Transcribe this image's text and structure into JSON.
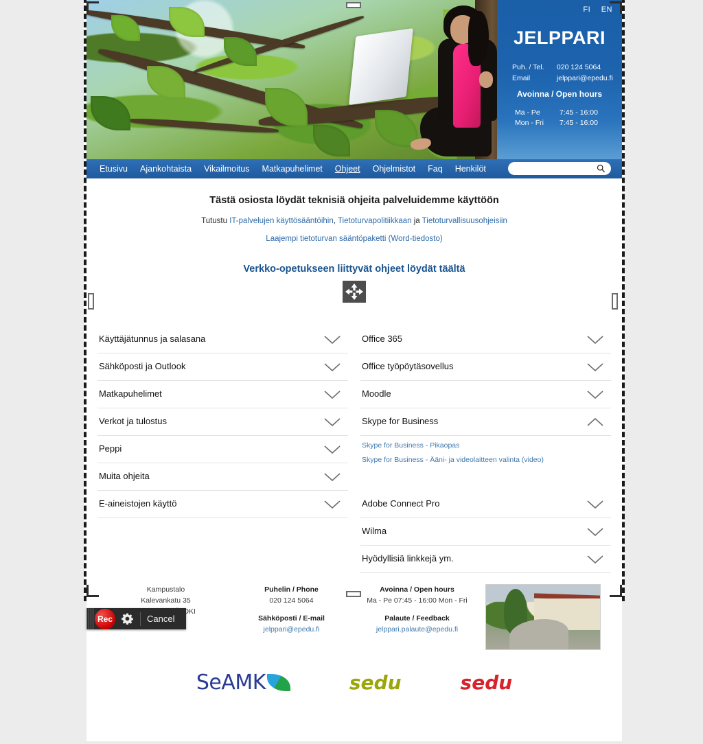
{
  "recorder": {
    "rec_label": "Rec",
    "cancel_label": "Cancel",
    "gear_icon": "gear-icon",
    "grip_icon": "drag-grip-icon"
  },
  "hero": {
    "lang": {
      "fi": "FI",
      "en": "EN"
    },
    "brand": "JELPPARI",
    "phone_label": "Puh. / Tel.",
    "phone_value": "020 124 5064",
    "email_label": "Email",
    "email_value": "jelppari@epedu.fi",
    "open_hours_title": "Avoinna / Open hours",
    "hours": [
      {
        "days": "Ma - Pe",
        "time": "7:45 - 16:00"
      },
      {
        "days": "Mon - Fri",
        "time": "7:45 - 16:00"
      }
    ]
  },
  "nav": {
    "items": [
      {
        "label": "Etusivu",
        "active": false
      },
      {
        "label": "Ajankohtaista",
        "active": false
      },
      {
        "label": "Vikailmoitus",
        "active": false
      },
      {
        "label": "Matkapuhelimet",
        "active": false
      },
      {
        "label": "Ohjeet",
        "active": true
      },
      {
        "label": "Ohjelmistot",
        "active": false
      },
      {
        "label": "Faq",
        "active": false
      },
      {
        "label": "Henkilöt",
        "active": false
      }
    ],
    "search_value": "",
    "search_placeholder": "",
    "search_icon": "search-icon"
  },
  "content": {
    "headline": "Tästä osiosta löydät teknisiä ohjeita palveluidemme käyttöön",
    "sub_prefix": "Tutustu ",
    "sub_link1": "IT-palvelujen käyttösääntöihin",
    "sub_sep1": ", ",
    "sub_link2": "Tietoturvapolitiikkaan",
    "sub_mid": " ja ",
    "sub_link3": "Tietoturvallisuusohjeisiin",
    "sub_link4": "Laajempi tietoturvan sääntöpaketti (Word-tiedosto)",
    "verkko_heading": "Verkko-opetukseen liittyvät ohjeet löydät täältä",
    "move_cursor_icon": "move-cursor-icon"
  },
  "accordion": {
    "left": [
      {
        "label": "Käyttäjätunnus ja salasana",
        "expanded": false
      },
      {
        "label": "Sähköposti ja Outlook",
        "expanded": false
      },
      {
        "label": "Matkapuhelimet",
        "expanded": false
      },
      {
        "label": "Verkot ja tulostus",
        "expanded": false
      },
      {
        "label": "Peppi",
        "expanded": false
      },
      {
        "label": "Muita ohjeita",
        "expanded": false
      },
      {
        "label": "E-aineistojen käyttö",
        "expanded": false
      }
    ],
    "right": [
      {
        "label": "Office 365",
        "expanded": false
      },
      {
        "label": "Office työpöytäsovellus",
        "expanded": false
      },
      {
        "label": "Moodle",
        "expanded": false
      },
      {
        "label": "Skype for Business",
        "expanded": true
      },
      {
        "label": "Adobe Connect Pro",
        "expanded": false
      },
      {
        "label": "Wilma",
        "expanded": false
      },
      {
        "label": "Hyödyllisiä linkkejä ym.",
        "expanded": false
      }
    ],
    "skype_links": [
      "Skype for Business - Pikaopas",
      "Skype for Business - Ääni- ja videolaitteen valinta (video)"
    ]
  },
  "footer": {
    "address": {
      "line1": "Kampustalo",
      "line2": "Kalevankatu 35",
      "line3": "60100 SEINÄJOKI"
    },
    "phone": {
      "title": "Puhelin / Phone",
      "value": "020 124 5064"
    },
    "email": {
      "title": "Sähköposti / E-mail",
      "value": "jelppari@epedu.fi"
    },
    "hours": {
      "title": "Avoinna / Open hours",
      "value": "Ma - Pe 07:45 - 16:00 Mon - Fri"
    },
    "feedback": {
      "title": "Palaute / Feedback",
      "value": "jelppari.palaute@epedu.fi"
    },
    "building_photo": "campus-building-photo",
    "logos": [
      {
        "name": "SeAMK",
        "text": "SeAMK",
        "color": "#2a3b96"
      },
      {
        "name": "sedu-olive",
        "text": "sedu",
        "color": "#9aa60a"
      },
      {
        "name": "sedu-red",
        "text": "sedu",
        "color": "#d8232a"
      }
    ]
  },
  "colors": {
    "nav_blue": "#1e5a9e",
    "panel_blue": "#1a5fa8",
    "link_blue": "#2f6caa",
    "heading_blue": "#18538f",
    "rec_red": "#cc0000"
  }
}
